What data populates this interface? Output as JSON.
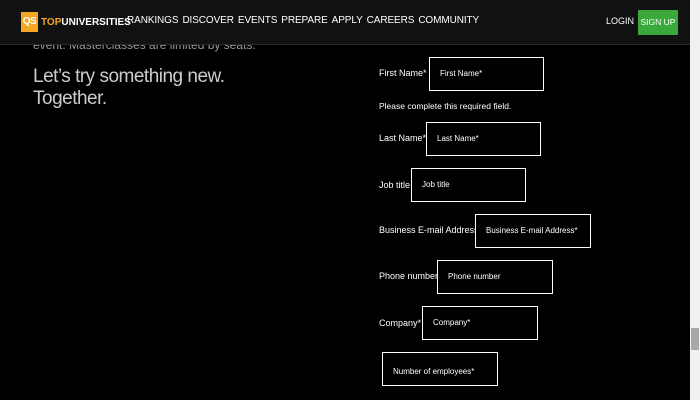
{
  "header": {
    "logo_mark": "QS",
    "logo_top": "TOP",
    "logo_rest": "UNIVERSITIES",
    "nav": [
      "RANKINGS",
      "DISCOVER",
      "EVENTS",
      "PREPARE",
      "APPLY",
      "CAREERS",
      "COMMUNITY"
    ],
    "login": "LOGIN",
    "signup": "SIGN UP",
    "brand_color": "#f5a623",
    "signup_color": "#3aa83a"
  },
  "hero": {
    "cut_text": "event. Masterclasses are limited by seats.",
    "tagline_line1": "Let’s try something new.",
    "tagline_line2": "Together."
  },
  "form": {
    "first_name": {
      "label": "First Name*",
      "placeholder": "First Name*"
    },
    "first_name_error": "Please complete this required field.",
    "last_name": {
      "label": "Last Name*",
      "placeholder": "Last Name*"
    },
    "job_title": {
      "label": "Job title",
      "placeholder": "Job title"
    },
    "email": {
      "label": "Business E-mail Address*",
      "placeholder": "Business E-mail Address*"
    },
    "phone": {
      "label": "Phone number",
      "placeholder": "Phone number"
    },
    "company": {
      "label": "Company*",
      "placeholder": "Company*"
    },
    "employees": {
      "placeholder": "Number of employees*"
    }
  }
}
